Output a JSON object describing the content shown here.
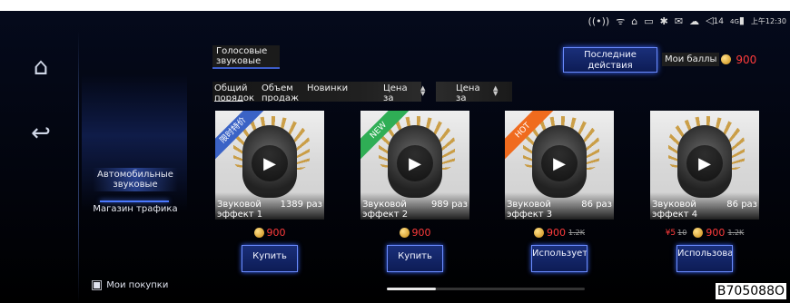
{
  "status": {
    "icons": [
      "cast-icon",
      "wifi-icon",
      "usb-icon",
      "battery-icon",
      "bluetooth-icon",
      "mail-icon",
      "weather-icon",
      "volume-icon",
      "signal-icon"
    ],
    "volume": "14",
    "network": "4G",
    "time": "上午12:30"
  },
  "rail": {
    "home_icon": "home-icon",
    "back_icon": "back-icon"
  },
  "side": {
    "items": [
      {
        "label": "Автомобильные звуковые"
      },
      {
        "label": "Магазин трафика"
      }
    ],
    "purchases_label": "Мои покупки"
  },
  "header": {
    "voice_tab": "Голосовые звуковые",
    "recent_button": "Последние действия",
    "points_label": "Мои баллы",
    "points_value": "900"
  },
  "sort": {
    "items": [
      "Общий порядок",
      "Объем продаж",
      "Новинки",
      "Цена за баллы",
      "Цена за деньги"
    ]
  },
  "cards": [
    {
      "ribbon": "限时特价",
      "ribbon_color": "#3b63c6",
      "name": "Звуковой эффект 1",
      "count": "1389 раз",
      "price": "900",
      "old_price": "",
      "rmb": "",
      "rmb_old": "",
      "action": "Купить"
    },
    {
      "ribbon": "NEW",
      "ribbon_color": "#2fae55",
      "name": "Звуковой эффект 2",
      "count": "989 раз",
      "price": "900",
      "old_price": "",
      "rmb": "",
      "rmb_old": "",
      "action": "Купить"
    },
    {
      "ribbon": "HOT",
      "ribbon_color": "#f06b1e",
      "name": "Звуковой эффект 3",
      "count": "86 раз",
      "price": "900",
      "old_price": "1.2K",
      "rmb": "",
      "rmb_old": "",
      "action": "Используется"
    },
    {
      "ribbon": "",
      "ribbon_color": "",
      "name": "Звуковой эффект 4",
      "count": "86 раз",
      "price": "900",
      "old_price": "1.2K",
      "rmb": "¥5",
      "rmb_old": "10",
      "action": "Использовать"
    }
  ],
  "scroll": {
    "position_fraction": 0.0
  },
  "watermark_code": "B705088O"
}
